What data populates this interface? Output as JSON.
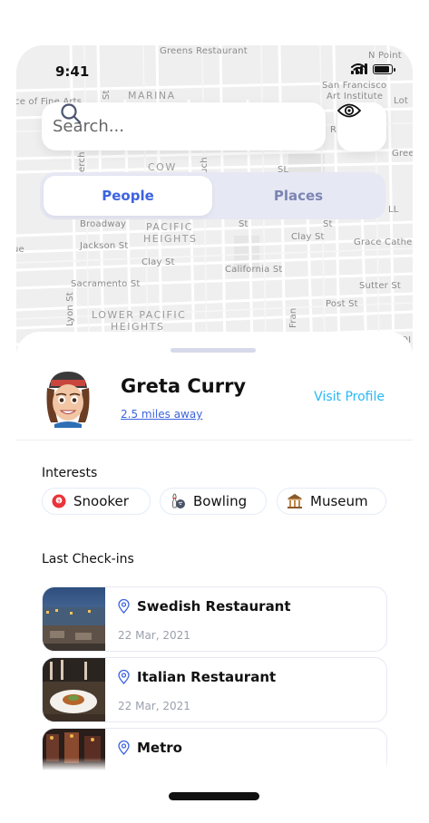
{
  "status_bar": {
    "time": "9:41"
  },
  "map": {
    "labels": {
      "greens_restaurant": "Greens Restaurant",
      "n_point": "N Point",
      "san_francisco_art_institute_1": "San Francisco",
      "san_francisco_art_institute_2": "Art Institute",
      "marina": "MARINA",
      "ce_of_fine_arts": "ce of Fine Arts",
      "cow": "COW",
      "broadway": "Broadway",
      "pacific_heights_1": "PACIFIC",
      "pacific_heights_2": "HEIGHTS",
      "jackson_st": "Jackson St",
      "clay_st_left": "Clay St",
      "clay_st_right": "Clay St",
      "california_st": "California St",
      "sacramento_st": "Sacramento St",
      "sutter_st": "Sutter St",
      "post_st": "Post St",
      "grace_cathedral": "Grace Cathed",
      "lower_pacific_heights_1": "LOWER PACIFIC",
      "lower_pacific_heights_2": "HEIGHTS",
      "lyon_st": "Lyon St",
      "fran": "Fran",
      "green": "Gree",
      "lot": "Lot",
      "r_letter": "R",
      "l_letters": "LL",
      "ol_letters": "OI",
      "st_frag_1": "St",
      "st_frag_2": "St",
      "st_frag_3": "St",
      "sl_frag": "SL",
      "erch": "erch",
      "uch": "uch",
      "ue": "ue"
    }
  },
  "search": {
    "placeholder": "Search...",
    "icon": "search-icon"
  },
  "eye_button": {
    "icon": "eye-icon"
  },
  "tabs": [
    {
      "label": "People",
      "active": true
    },
    {
      "label": "Places",
      "active": false
    }
  ],
  "profile": {
    "name": "Greta Curry",
    "distance": "2.5 miles away",
    "visit_label": "Visit Profile",
    "avatar_icon": "memoji-avatar"
  },
  "interests": {
    "title": "Interests",
    "items": [
      {
        "label": "Snooker",
        "icon": "snooker-ball-icon"
      },
      {
        "label": "Bowling",
        "icon": "bowling-icon"
      },
      {
        "label": "Museum",
        "icon": "museum-icon"
      }
    ]
  },
  "checkins": {
    "title": "Last Check-ins",
    "items": [
      {
        "name": "Swedish Restaurant",
        "date": "22 Mar, 2021"
      },
      {
        "name": "Italian Restaurant",
        "date": "22 Mar, 2021"
      },
      {
        "name": "Metro",
        "date": ""
      }
    ]
  },
  "colors": {
    "accent": "#3d63e0",
    "link": "#27b8f5",
    "segment_bg": "#e6e8f4",
    "inactive_tab": "#7c85b3"
  }
}
